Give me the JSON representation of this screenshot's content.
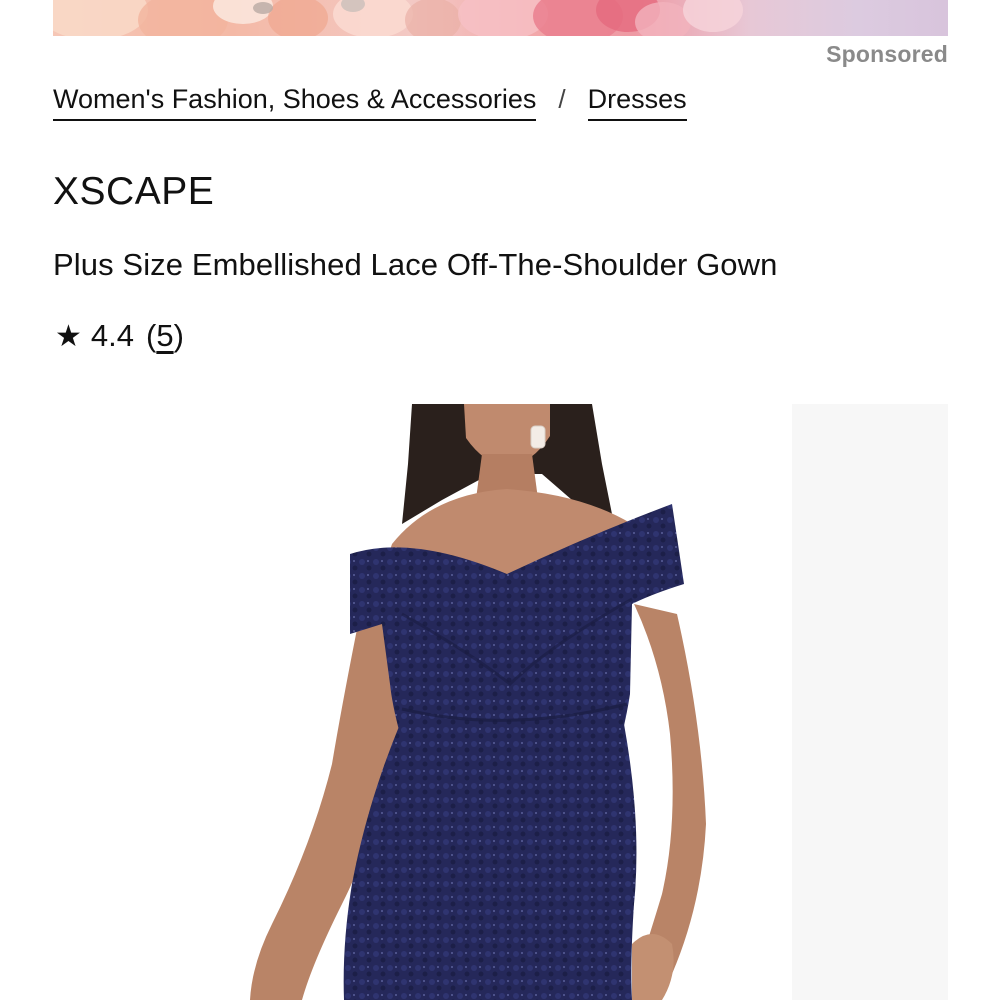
{
  "ad": {
    "sponsored_label": "Sponsored"
  },
  "breadcrumb": {
    "items": [
      {
        "label": "Women's Fashion, Shoes & Accessories"
      },
      {
        "label": "Dresses"
      }
    ],
    "separator": "/"
  },
  "product": {
    "brand": "XSCAPE",
    "title": "Plus Size Embellished Lace Off-The-Shoulder Gown",
    "rating": {
      "star_icon": "star-icon",
      "value": "4.4",
      "open_paren": "(",
      "review_count": "5",
      "close_paren": ")"
    },
    "image_colors": {
      "dress": "#25285a",
      "skin": "#c08a6e",
      "hair": "#2a201c"
    }
  }
}
